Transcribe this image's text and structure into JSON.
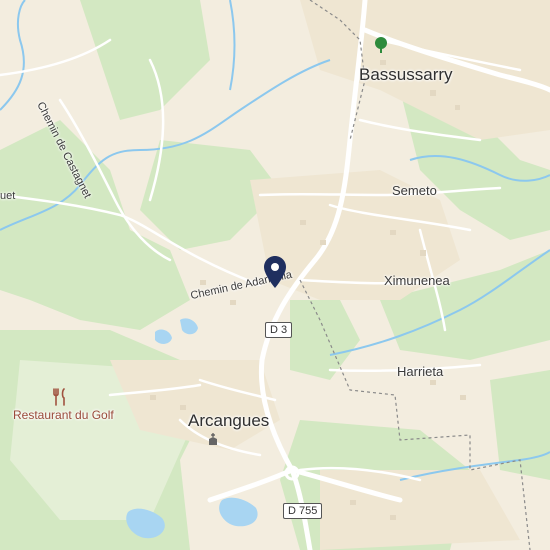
{
  "map": {
    "places": {
      "bassussarry": "Bassussarry",
      "arcangues": "Arcangues",
      "semeto": "Semeto",
      "ximunenea": "Ximunenea",
      "harrieta": "Harrieta"
    },
    "streets": {
      "chemin_castagnet": "Chemin de Castagnet",
      "chemin_adarrenia": "Chemin de Adarrenia",
      "partial_left": "uet"
    },
    "road_shields": {
      "d3": "D 3",
      "d755": "D 755"
    },
    "poi": {
      "restaurant": "Restaurant du Golf"
    },
    "icons": {
      "marker": "location-pin-icon",
      "restaurant": "fork-knife-icon",
      "church": "church-icon",
      "park": "tree-icon"
    },
    "colors": {
      "land": "#f3eddf",
      "forest": "#cfe6bd",
      "water": "#a8d5f2",
      "river": "#8cc8ee",
      "road_major": "#ffffff",
      "marker": "#1f2f5f"
    }
  }
}
